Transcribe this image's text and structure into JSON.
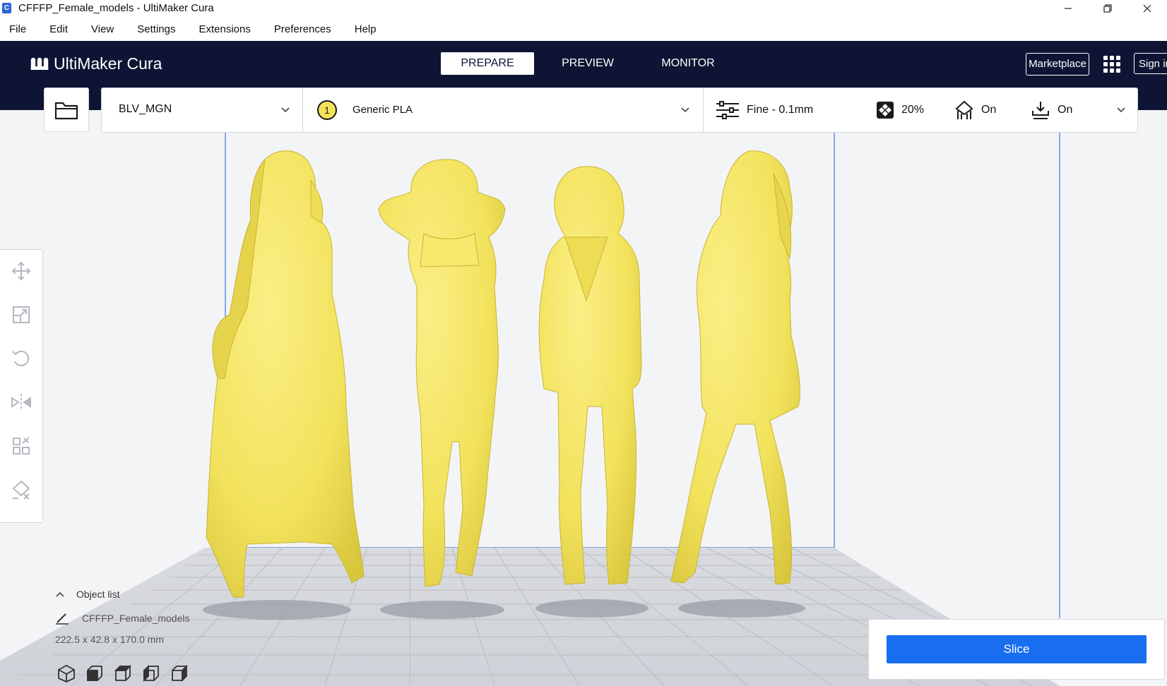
{
  "window": {
    "title": "CFFFP_Female_models - UltiMaker Cura",
    "app_icon_letter": "C",
    "controls": [
      "minimize",
      "restore",
      "close"
    ]
  },
  "menu": [
    "File",
    "Edit",
    "View",
    "Settings",
    "Extensions",
    "Preferences",
    "Help"
  ],
  "header": {
    "logo_text": "UltiMaker Cura",
    "stages": [
      {
        "label": "PREPARE",
        "active": true
      },
      {
        "label": "PREVIEW",
        "active": false
      },
      {
        "label": "MONITOR",
        "active": false
      }
    ],
    "marketplace_label": "Marketplace",
    "signin_label": "Sign in"
  },
  "toolbar": {
    "printer": "BLV_MGN",
    "extruder_number": "1",
    "material": "Generic PLA",
    "profile": "Fine - 0.1mm",
    "infill": "20%",
    "support": "On",
    "adhesion": "On"
  },
  "left_tools": [
    "move-tool",
    "scale-tool",
    "rotate-tool",
    "mirror-tool",
    "per-model-settings-tool",
    "support-blocker-tool"
  ],
  "object_list": {
    "header_label": "Object list",
    "item_name": "CFFFP_Female_models",
    "dimensions": "222.5 x 42.8 x 170.0 mm"
  },
  "view_buttons": [
    "3d-view",
    "front-view",
    "top-view",
    "left-view",
    "right-view"
  ],
  "slice": {
    "button_label": "Slice"
  },
  "colors": {
    "header_bg": "#0e1433",
    "accent_blue": "#196ef0",
    "model_yellow": "#f2e25c",
    "viewport_bg": "#f3f4f6",
    "grid_line": "#b9bcc3"
  }
}
